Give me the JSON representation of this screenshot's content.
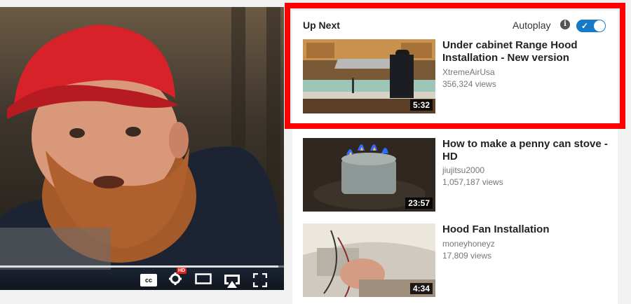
{
  "player": {
    "progress_fraction": 0.98,
    "controls": {
      "cc_label": "cc",
      "hd_badge": "HD",
      "icons": [
        "captions-icon",
        "settings-icon",
        "theater-mode-icon",
        "airplay-icon",
        "fullscreen-icon"
      ]
    }
  },
  "sidebar": {
    "up_next_label": "Up Next",
    "autoplay_label": "Autoplay",
    "info_symbol": "i",
    "autoplay_on": true,
    "highlight_color": "#ff0000",
    "videos": [
      {
        "title": "Under cabinet Range Hood Installation - New version",
        "channel": "XtremeAirUsa",
        "views": "356,324 views",
        "duration": "5:32"
      },
      {
        "title": "How to make a penny can stove - HD",
        "channel": "jiujitsu2000",
        "views": "1,057,187 views",
        "duration": "23:57"
      },
      {
        "title": "Hood Fan Installation",
        "channel": "moneyhoneyz",
        "views": "17,809 views",
        "duration": "4:34"
      }
    ]
  }
}
